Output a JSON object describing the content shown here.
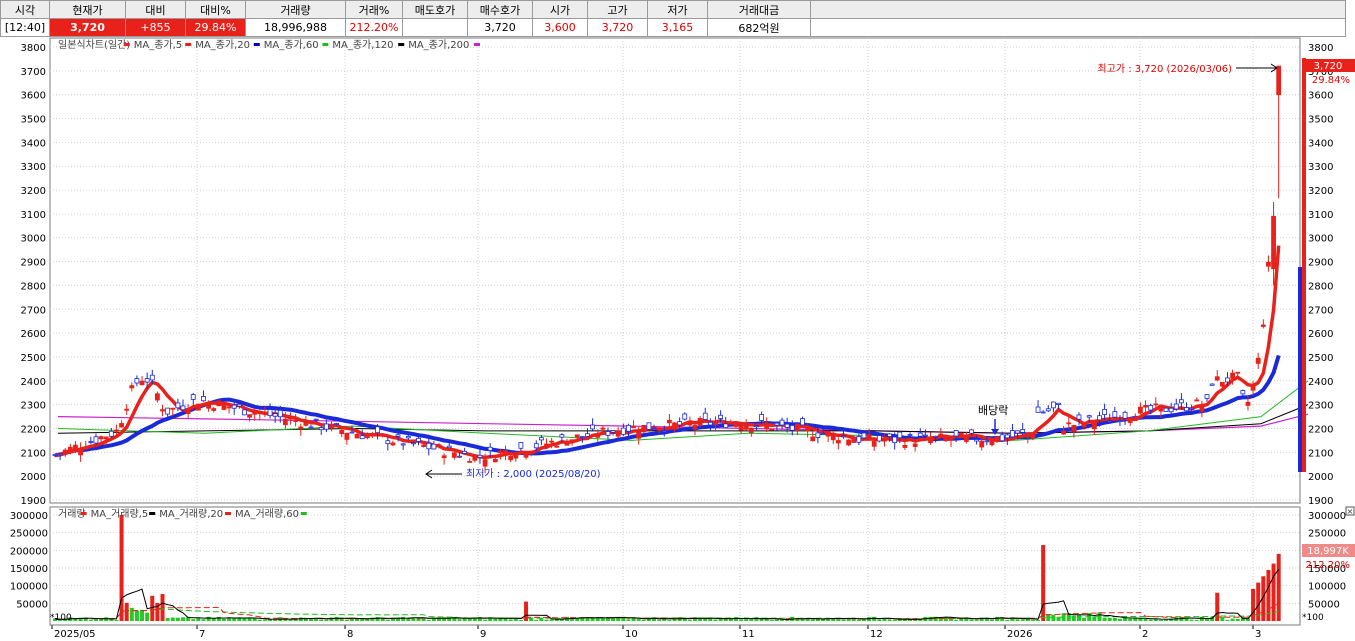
{
  "quote": {
    "headers": [
      "시각",
      "현재가",
      "대비",
      "대비%",
      "거래량",
      "거래%",
      "매도호가",
      "매수호가",
      "시가",
      "고가",
      "저가",
      "거래대금"
    ],
    "values": [
      "[12:40]",
      "3,720",
      "+855",
      "29.84%",
      "18,996,988",
      "212.20%",
      "",
      "3,720",
      "3,600",
      "3,720",
      "3,165",
      "682억원"
    ]
  },
  "price_panel": {
    "legend": [
      {
        "label": "일본식차트(일간)",
        "color": "#e8221b"
      },
      {
        "label": "MA_종가,5",
        "color": "#e8221b"
      },
      {
        "label": "MA_종가,20",
        "color": "#0000cc"
      },
      {
        "label": "MA_종가,60",
        "color": "#22bb22"
      },
      {
        "label": "MA_종가,120",
        "color": "#000000"
      },
      {
        "label": "MA_종가,200",
        "color": "#cc22cc"
      }
    ],
    "y_ticks": [
      "3800",
      "3700",
      "3600",
      "3500",
      "3400",
      "3300",
      "3200",
      "3100",
      "3000",
      "2900",
      "2800",
      "2700",
      "2600",
      "2500",
      "2400",
      "2300",
      "2200",
      "2100",
      "2000",
      "1900"
    ],
    "high_annotation": "최고가 : 3,720 (2026/03/06)",
    "low_annotation": "최저가 : 2,000 (2025/08/20)",
    "dividend_label": "배당락",
    "current_price_tag": "3,720",
    "change_pct_tag": "29.84%"
  },
  "volume_panel": {
    "legend": [
      {
        "label": "거래량",
        "color": "#e8221b"
      },
      {
        "label": "MA_거래량,5",
        "color": "#000000"
      },
      {
        "label": "MA_거래량,20",
        "color": "#e8221b"
      },
      {
        "label": "MA_거래량,60",
        "color": "#22bb22"
      }
    ],
    "y_ticks": [
      "300000",
      "250000",
      "200000",
      "150000",
      "100000",
      "50000"
    ],
    "unit_label": "*100",
    "volume_tag": "18,997K",
    "volume_pct_tag": "212.20%"
  },
  "x_axis": {
    "labels": [
      "2025/05",
      "7",
      "8",
      "9",
      "10",
      "11",
      "12",
      "2026",
      "2",
      "3"
    ]
  },
  "chart_data": {
    "type": "candlestick",
    "title": "일본식차트(일간)",
    "price_range": [
      1900,
      3800
    ],
    "volume_range": [
      0,
      300000
    ],
    "volume_unit": "*100",
    "months": [
      "2025/05",
      "2025/06",
      "2025/07",
      "2025/08",
      "2025/09",
      "2025/10",
      "2025/11",
      "2025/12",
      "2026/01",
      "2026/02",
      "2026/03"
    ],
    "close_by_month": [
      2080,
      2320,
      2190,
      2080,
      2200,
      2230,
      2150,
      2160,
      2270,
      2330,
      3720
    ],
    "ma60_by_month": [
      2200,
      2180,
      2210,
      2180,
      2150,
      2180,
      2170,
      2150,
      2190,
      2250,
      2400
    ],
    "ma120_by_month": [
      2180,
      2190,
      2200,
      2190,
      2190,
      2190,
      2190,
      2180,
      2190,
      2220,
      2300
    ],
    "ma200_by_month": [
      2250,
      2240,
      2230,
      2220,
      2210,
      2200,
      2190,
      2180,
      2190,
      2210,
      2260
    ],
    "high": {
      "value": 3720,
      "date": "2026/03/06"
    },
    "low": {
      "value": 2000,
      "date": "2025/08/20"
    },
    "notable_volume_days": [
      {
        "month": "2025/06",
        "volume": 300000
      },
      {
        "month": "2025/09",
        "volume": 55000
      },
      {
        "month": "2026/01",
        "volume": 215000
      },
      {
        "month": "2026/03",
        "volume": 189970
      }
    ]
  },
  "colors": {
    "up": "#e8221b",
    "down": "#1a2ad8",
    "ma5": "#e8221b",
    "ma20": "#1a2ad8",
    "ma60": "#22bb22",
    "ma120": "#000000",
    "ma200": "#cc22cc",
    "grid": "#d0d0d0"
  }
}
